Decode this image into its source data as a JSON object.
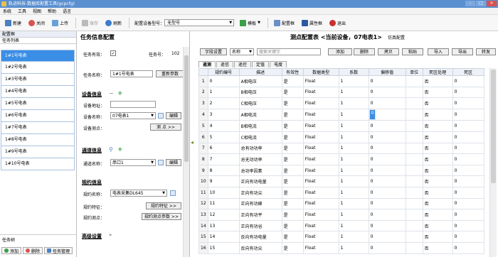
{
  "window": {
    "title": "轨迹科技-数据库配置工具(gcpcfg)",
    "controls": [
      "–",
      "□",
      "×"
    ]
  },
  "menu": [
    "系统",
    "工具",
    "视图",
    "帮助",
    "语言"
  ],
  "toolbar": {
    "new": "新建",
    "close": "关闭",
    "upload": "上传",
    "save": "保存",
    "refresh": "刷新",
    "device_model_label": "配置设备型号：",
    "device_model_value": "无型号",
    "template": "模板",
    "config_box": "配置框",
    "property_box": "属性框",
    "exit": "退出"
  },
  "left_panel": {
    "header": "配置框",
    "list_title": "任务列表",
    "tasks": [
      "1#1号电表",
      "1#2号电表",
      "1#3号电表",
      "1#4号电表",
      "1#5号电表",
      "1#6号电表",
      "1#7号电表",
      "1#8号电表",
      "1#9号电表",
      "1#10号电表"
    ],
    "footer_title": "任务树",
    "add": "添加",
    "delete": "删除",
    "task_mgmt": "任务管理"
  },
  "task_info": {
    "title": "任务信息配置",
    "valid_label": "任务有效：",
    "id_label": "任务号：",
    "id_value": "102",
    "name_label": "任务名称：",
    "name_value": "1#1号电表",
    "rename": "重新参数",
    "device_section": "设备信息",
    "device_addr_label": "设备地址：",
    "device_name_label": "设备名称：",
    "device_name_value": "07电表1",
    "edit": "编辑",
    "measure_label": "设备测点：",
    "measure_btn": "测 点 >>",
    "channel_section": "通道信息",
    "channel_name_label": "通道名称：",
    "channel_name_value": "串口1",
    "channel_edit": "编辑",
    "protocol_section": "规约信息",
    "protocol_name_label": "规约名称：",
    "protocol_name_value": "电表采集DL645",
    "protocol_feature_label": "规约特征：",
    "protocol_feature_btn": "规约特征 >>",
    "protocol_point_label": "规约测点：",
    "protocol_point_btn": "规约测点参数 >>",
    "advanced_section": "高级设置"
  },
  "measure": {
    "title": "测点配置表 <当前设备，07电表1>",
    "simulate": "仿真配置",
    "field_settings": "字段设置",
    "field_select": "名称",
    "search_placeholder": "搜索关键字",
    "add": "添加",
    "delete": "删除",
    "copy": "拷贝",
    "paste": "粘贴",
    "import": "导入",
    "export": "导出",
    "convert": "转发",
    "tabs": [
      "遥测",
      "遥信",
      "遥控",
      "定值",
      "电度"
    ],
    "columns": [
      "规约编号",
      "描述",
      "有效性",
      "数据类型",
      "系数",
      "偏移值",
      "单位",
      "死区处理",
      "死区"
    ],
    "rows": [
      [
        "1",
        "0",
        "A相电压",
        "是",
        "Float",
        "1",
        "0",
        "",
        "否",
        "0"
      ],
      [
        "2",
        "1",
        "B相电压",
        "是",
        "Float",
        "1",
        "0",
        "",
        "否",
        "0"
      ],
      [
        "3",
        "2",
        "C相电压",
        "是",
        "Float",
        "1",
        "0",
        "",
        "否",
        "0"
      ],
      [
        "4",
        "3",
        "A相电流",
        "是",
        "Float",
        "1",
        "0",
        "",
        "否",
        "0"
      ],
      [
        "5",
        "4",
        "B相电流",
        "是",
        "Float",
        "1",
        "0",
        "",
        "否",
        "0"
      ],
      [
        "6",
        "5",
        "C相电流",
        "是",
        "Float",
        "1",
        "0",
        "",
        "否",
        "0"
      ],
      [
        "7",
        "6",
        "总有功功率",
        "是",
        "Float",
        "1",
        "0",
        "",
        "否",
        "0"
      ],
      [
        "8",
        "7",
        "总无功功率",
        "是",
        "Float",
        "1",
        "0",
        "",
        "否",
        "0"
      ],
      [
        "9",
        "8",
        "总功率因素",
        "是",
        "Float",
        "1",
        "0",
        "",
        "否",
        "0"
      ],
      [
        "10",
        "9",
        "正向有功电量",
        "是",
        "Float",
        "1",
        "0",
        "",
        "否",
        "0"
      ],
      [
        "11",
        "10",
        "正向有功尖",
        "是",
        "Float",
        "1",
        "0",
        "",
        "否",
        "0"
      ],
      [
        "12",
        "11",
        "正向有功峰",
        "是",
        "Float",
        "1",
        "0",
        "",
        "否",
        "0"
      ],
      [
        "13",
        "12",
        "正向有功平",
        "是",
        "Float",
        "1",
        "0",
        "",
        "否",
        "0"
      ],
      [
        "14",
        "13",
        "正向有功谷",
        "是",
        "Float",
        "1",
        "0",
        "",
        "否",
        "0"
      ],
      [
        "15",
        "14",
        "反向有功电量",
        "是",
        "Float",
        "1",
        "0",
        "",
        "否",
        "0"
      ],
      [
        "16",
        "15",
        "反向有功尖",
        "是",
        "Float",
        "1",
        "0",
        "",
        "否",
        "0"
      ]
    ]
  }
}
